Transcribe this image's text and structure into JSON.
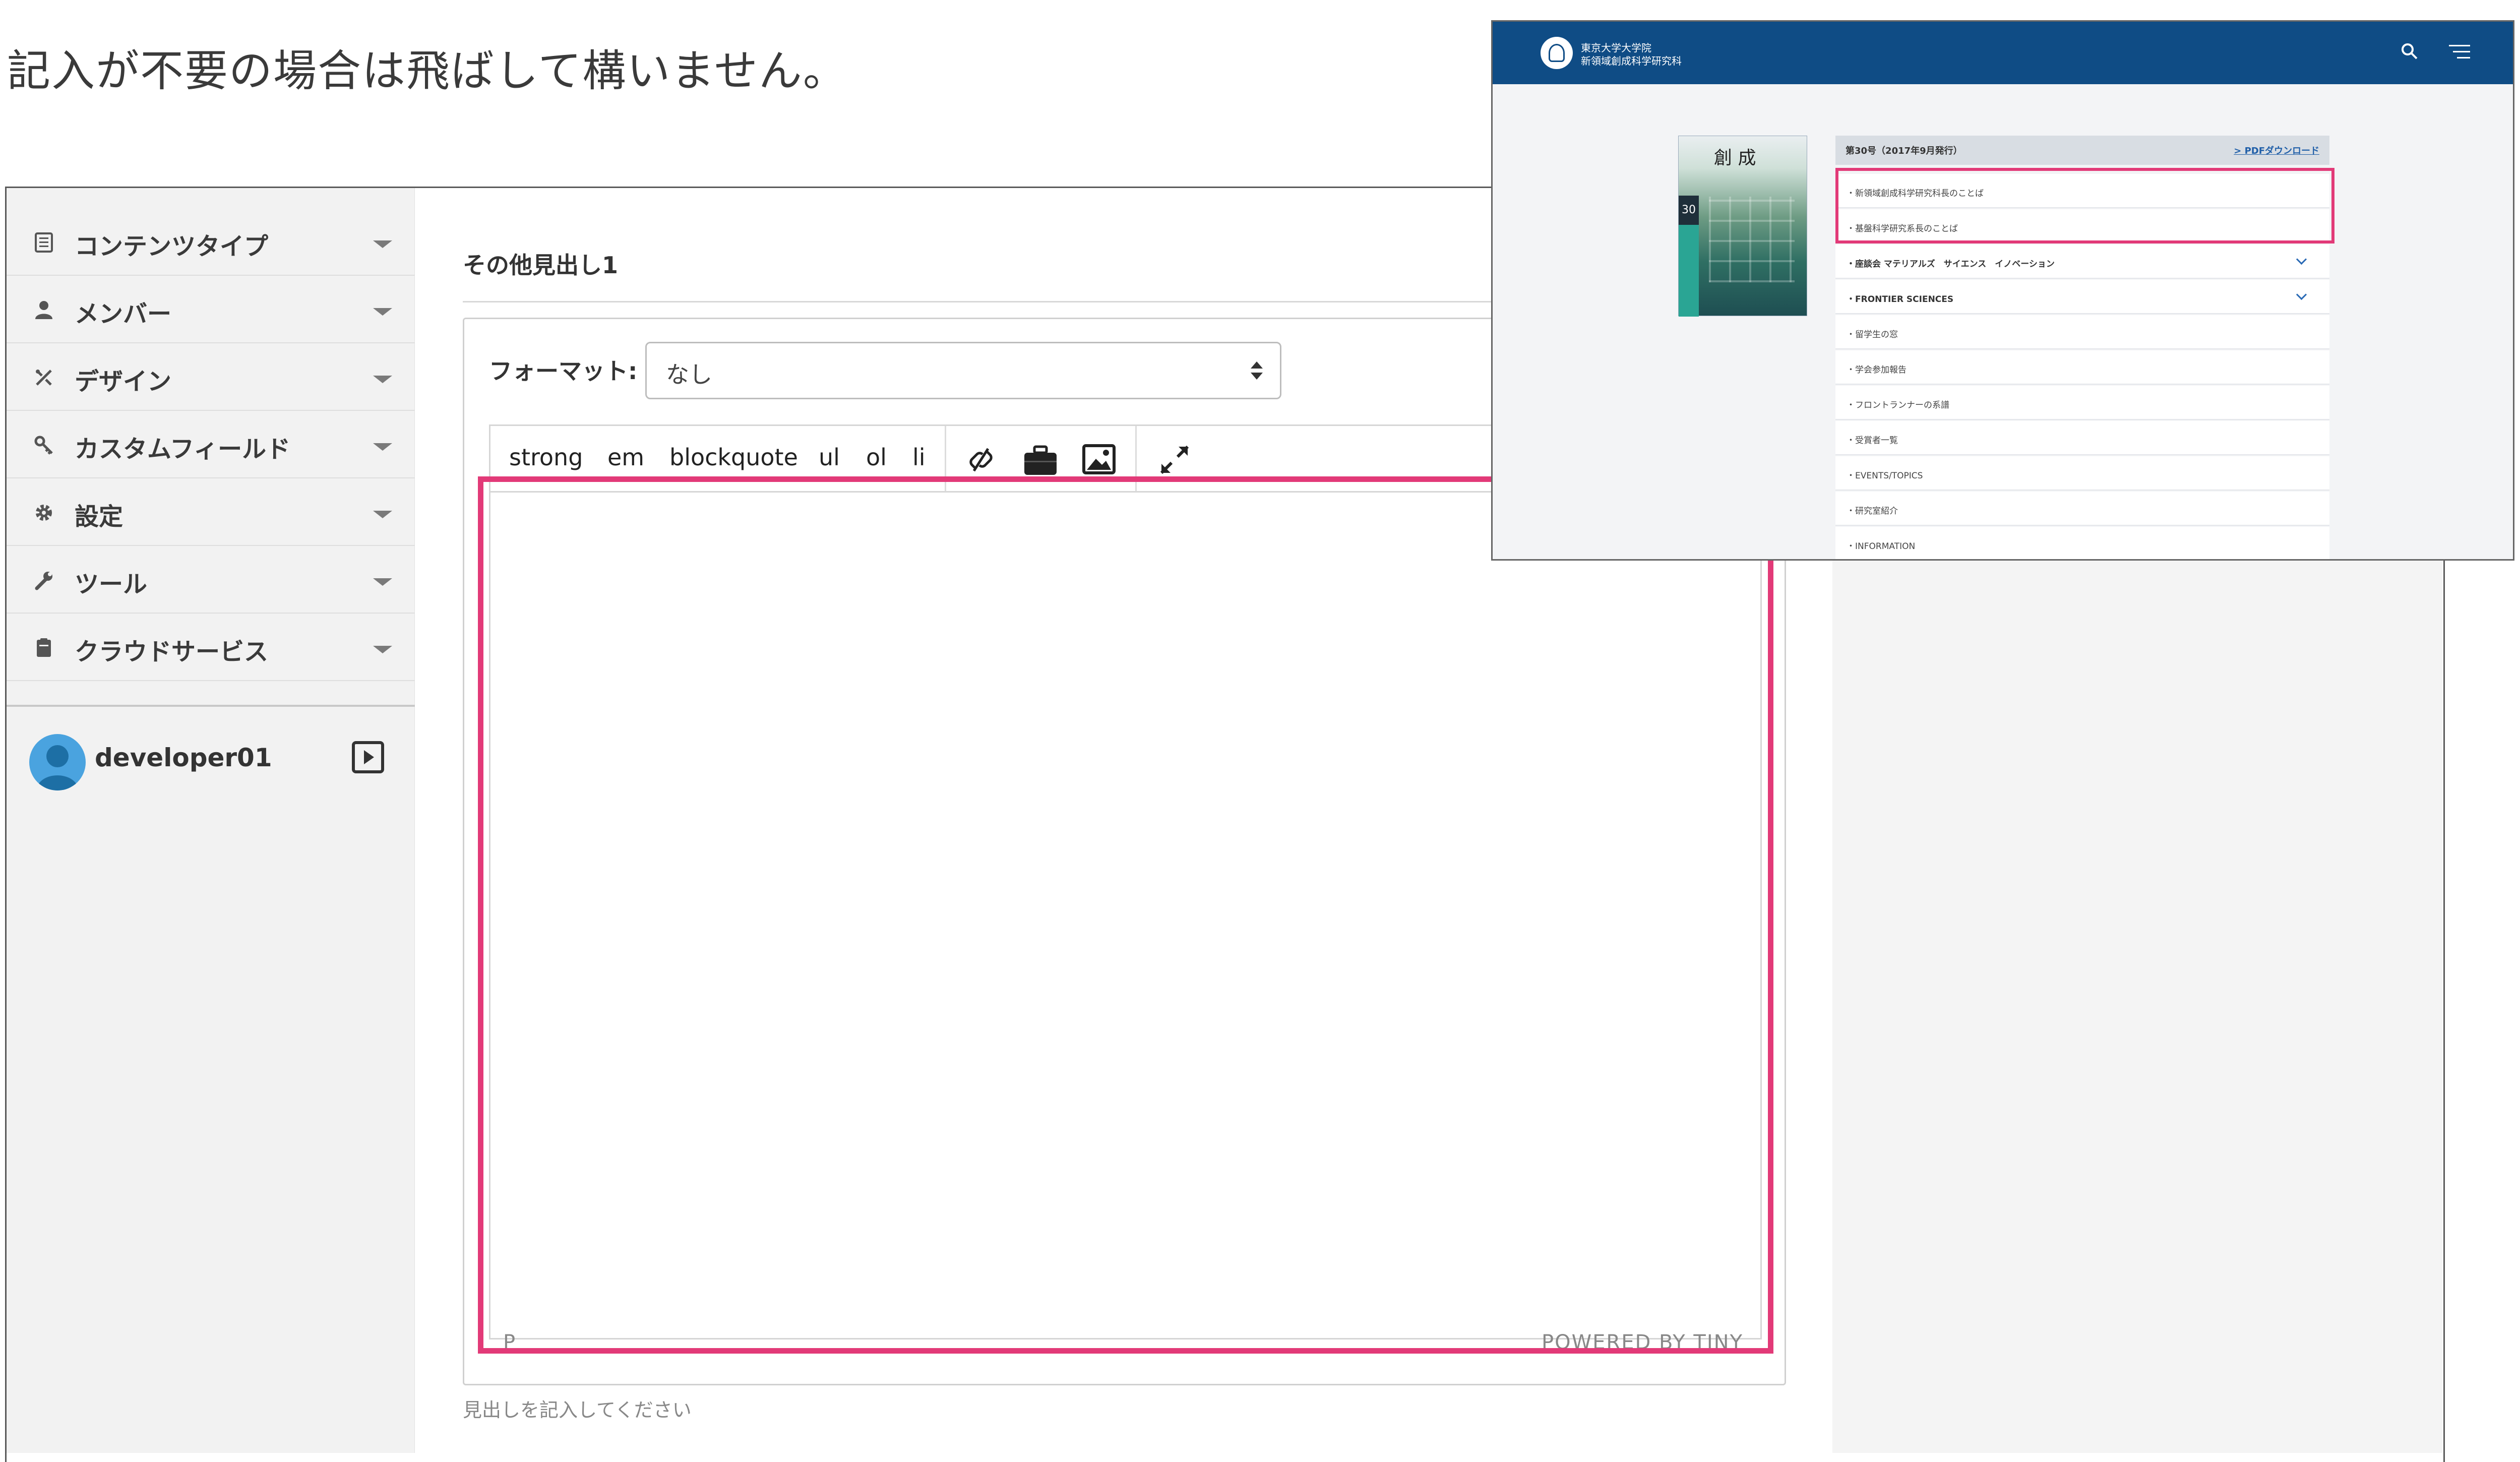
{
  "instruction": "記入が不要の場合は飛ばして構いません。",
  "sidebar": {
    "items": [
      {
        "label": "コンテンツタイプ",
        "icon": "document-icon"
      },
      {
        "label": "メンバー",
        "icon": "person-icon"
      },
      {
        "label": "デザイン",
        "icon": "design-tools-icon"
      },
      {
        "label": "カスタムフィールド",
        "icon": "keys-icon"
      },
      {
        "label": "設定",
        "icon": "gear-icon"
      },
      {
        "label": "ツール",
        "icon": "wrench-icon"
      },
      {
        "label": "クラウドサービス",
        "icon": "clipboard-icon"
      }
    ],
    "user": {
      "name": "developer01"
    }
  },
  "field": {
    "title": "その他見出し1",
    "format_label": "フォーマット:",
    "format_value": "なし",
    "help_text": "見出しを記入してください"
  },
  "editor": {
    "toolbar": [
      "strong",
      "em",
      "blockquote",
      "ul",
      "ol",
      "li"
    ],
    "toolbar_icons": [
      "link-icon",
      "briefcase-icon",
      "image-icon",
      "fullscreen-icon"
    ],
    "status_path": "P",
    "powered_by": "POWERED BY TINY"
  },
  "screenshot": {
    "brand_line1": "東京大学大学院",
    "brand_line2": "新領域創成科学研究科",
    "cover_title": "創 成",
    "cover_number": "30",
    "issue_title": "第30号（2017年9月発行）",
    "pdf_link": "> PDFダウンロード",
    "rows": [
      {
        "text": "・新領域創成科学研究科長のことば",
        "bold": false,
        "chevron": false
      },
      {
        "text": "・基盤科学研究系長のことば",
        "bold": false,
        "chevron": false
      },
      {
        "text": "・座談会 マテリアルズ　サイエンス　イノベーション",
        "bold": true,
        "chevron": true
      },
      {
        "text": "・FRONTIER SCIENCES",
        "bold": true,
        "chevron": true
      },
      {
        "text": "・留学生の窓",
        "bold": false,
        "chevron": false
      },
      {
        "text": "・学会参加報告",
        "bold": false,
        "chevron": false
      },
      {
        "text": "・フロントランナーの系譜",
        "bold": false,
        "chevron": false
      },
      {
        "text": "・受賞者一覧",
        "bold": false,
        "chevron": false
      },
      {
        "text": "・EVENTS/TOPICS",
        "bold": false,
        "chevron": false
      },
      {
        "text": "・研究室紹介",
        "bold": false,
        "chevron": false
      },
      {
        "text": "・INFORMATION",
        "bold": false,
        "chevron": false
      }
    ]
  },
  "colors": {
    "highlight": "#e23a78",
    "header_blue": "#0f4c85",
    "link_blue": "#1f5ea8"
  }
}
